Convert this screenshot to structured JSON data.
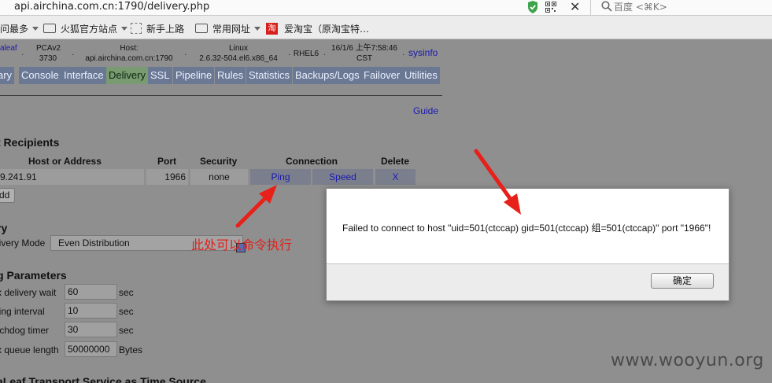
{
  "browser": {
    "url": "api.airchina.com.cn:1790/delivery.php",
    "search_placeholder": "百度 <⌘K>",
    "bookmarks": [
      {
        "label": "问最多",
        "has_caret": true
      },
      {
        "label": "火狐官方站点",
        "has_caret": true
      },
      {
        "label": "新手上路",
        "has_caret": false
      },
      {
        "label": "常用网址",
        "has_caret": true
      },
      {
        "label": "爱淘宝（原淘宝特…",
        "has_caret": false
      }
    ],
    "taobao_glyph": "淘"
  },
  "info_bar": {
    "items": [
      {
        "line1": "aleaf",
        "line2": ""
      },
      {
        "line1": "PCAv2",
        "line2": "3730"
      },
      {
        "line1": "Host:",
        "line2": "api.airchina.com.cn:1790"
      },
      {
        "line1": "Linux",
        "line2": "2.6.32-504.el6.x86_64"
      },
      {
        "line1": "RHEL6",
        "line2": ""
      },
      {
        "line1": "16/1/6 上午7:58:46",
        "line2": "CST"
      }
    ],
    "sysinfo": "sysinfo"
  },
  "tabs": [
    {
      "label": "ary",
      "active": false
    },
    {
      "label": "Console",
      "active": false
    },
    {
      "label": "Interface",
      "active": false
    },
    {
      "label": "Delivery",
      "active": true
    },
    {
      "label": "SSL",
      "active": false
    },
    {
      "label": "Pipeline",
      "active": false
    },
    {
      "label": "Rules",
      "active": false
    },
    {
      "label": "Statistics",
      "active": false
    },
    {
      "label": "Backups/Logs",
      "active": false
    },
    {
      "label": "Failover",
      "active": false
    },
    {
      "label": "Utilities",
      "active": false
    }
  ],
  "guide_link": "Guide",
  "recipients": {
    "heading": "t Recipients",
    "columns": [
      "Host or Address",
      "Port",
      "Security",
      "Connection",
      "Delete"
    ],
    "row": {
      "host": "9.241.91",
      "port": "1966",
      "security": "none",
      "ping": "Ping",
      "speed": "Speed",
      "delete": "X"
    },
    "add_button": "dd"
  },
  "delivery": {
    "heading": "ry",
    "mode_label": "livery Mode",
    "mode_value": "Even Distribution"
  },
  "annotation": "此处可以命令执行",
  "parameters": {
    "heading": "g Parameters",
    "rows": [
      {
        "label": "x delivery wait",
        "value": "60",
        "unit": "sec"
      },
      {
        "label": "ling interval",
        "value": "10",
        "unit": "sec"
      },
      {
        "label": "tchdog timer",
        "value": "30",
        "unit": "sec"
      },
      {
        "label": "x queue length",
        "value": "50000000",
        "unit": "Bytes"
      }
    ]
  },
  "bottom_heading": "aLeaf Transport Service as Time Source",
  "dialog": {
    "message": "Failed to connect to host \"uid=501(ctccap) gid=501(ctccap) 组=501(ctccap)\" port \"1966\"!",
    "ok_label": "确定"
  },
  "watermark": "www.wooyun.org",
  "colors": {
    "arrow": "#e8201a",
    "tab": "#6a7893",
    "tab_active": "#7a9a72",
    "link": "#1a1ab0"
  }
}
